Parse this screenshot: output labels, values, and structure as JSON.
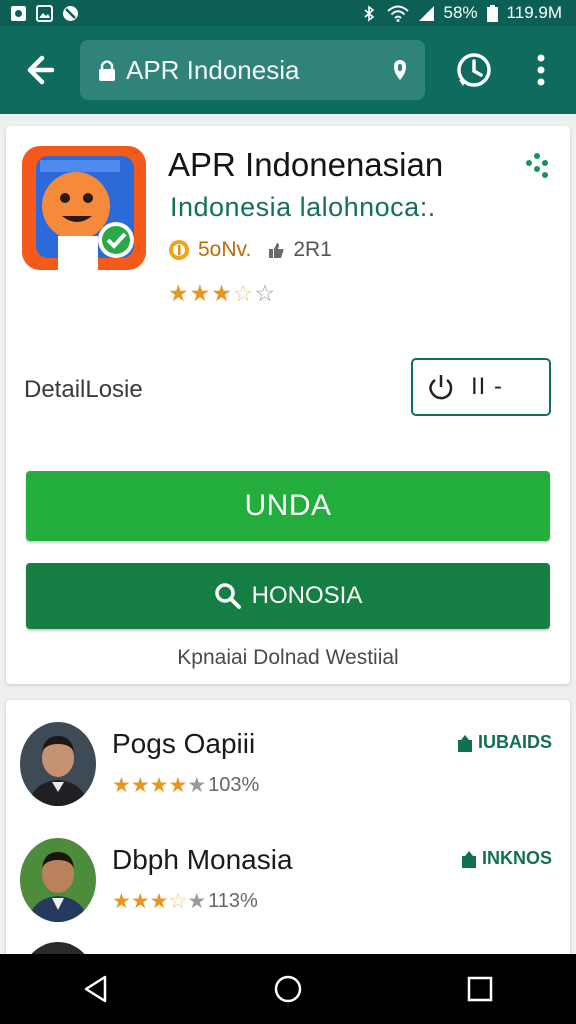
{
  "status_bar": {
    "battery": "58%",
    "time": "119.9M"
  },
  "browser": {
    "url": "APR Indonesia"
  },
  "app": {
    "title": "APR Indonenasian",
    "subtitle": "Indonesia lalohnoca:.",
    "meta_count": "5oNv.",
    "meta_votes": "2R1",
    "rating_stars": 3.5,
    "details_label": "DetailLosie",
    "toggle_label": "II -",
    "primary_button": "UNDA",
    "secondary_button": "HONOSIA",
    "footer_note": "Kpnaiai Dolnad Westiial"
  },
  "reviews": [
    {
      "name": "Pogs Oapiii",
      "rating": "103%",
      "badge": "IUBAIDS",
      "stars": 4
    },
    {
      "name": "Dbph Monasia",
      "rating": "113%",
      "badge": "INKNOS",
      "stars": 3.5
    }
  ],
  "colors": {
    "status_bar": "#0d5e54",
    "app_bar": "#0f6b5e",
    "primary_green": "#22ad3d",
    "secondary_green": "#157f43",
    "star": "#e8961f"
  }
}
